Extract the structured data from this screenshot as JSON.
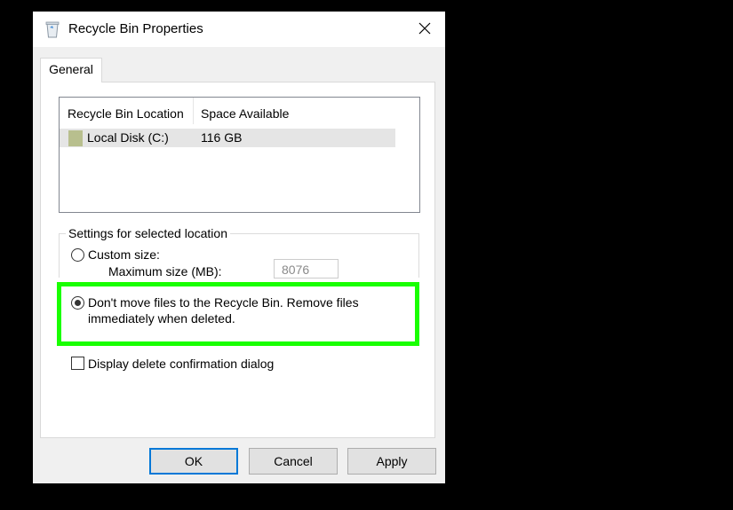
{
  "window": {
    "title": "Recycle Bin Properties",
    "close_glyph": "✕"
  },
  "tabs": [
    {
      "label": "General",
      "selected": true
    }
  ],
  "list": {
    "columns": [
      "Recycle Bin Location",
      "Space Available"
    ],
    "rows": [
      {
        "location": "Local Disk (C:)",
        "space": "116 GB",
        "icon": "drive-icon"
      }
    ]
  },
  "settings": {
    "group_label": "Settings for selected location",
    "custom_size_label": "Custom size:",
    "custom_size_checked": false,
    "max_size_label": "Maximum size (MB):",
    "max_size_value": "8076",
    "dont_move_line1": "Don't move files to the Recycle Bin. Remove files",
    "dont_move_line2": "immediately when deleted.",
    "dont_move_checked": true,
    "confirm_label": "Display delete confirmation dialog",
    "confirm_checked": false
  },
  "buttons": {
    "ok": "OK",
    "cancel": "Cancel",
    "apply": "Apply"
  },
  "colors": {
    "highlight": "#19ff00",
    "default_button_border": "#0078d7"
  }
}
